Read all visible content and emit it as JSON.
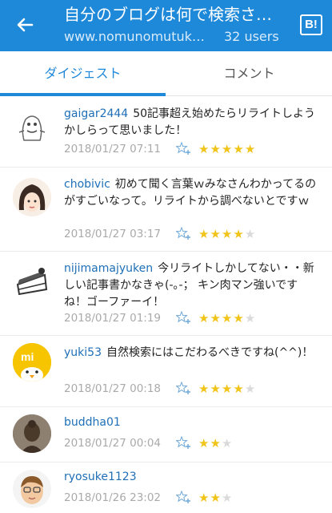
{
  "header": {
    "title": "自分のブログは何で検索さ…",
    "url": "www.nomunomutuk…",
    "users": "32 users",
    "hatena_logo": "B!",
    "back_icon": "arrow-left-icon",
    "background": "#1e88d9"
  },
  "tabs": [
    {
      "label": "ダイジェスト",
      "active": true
    },
    {
      "label": "コメント",
      "active": false
    }
  ],
  "comments": [
    {
      "user": "gaigar2444",
      "text": "50記事超え始めたらリライトしようかしらって思いました！",
      "date": "2018/01/27 07:11",
      "stars": 5,
      "max_stars": 5
    },
    {
      "user": "chobivic",
      "text": "初めて聞く言葉ｗみなさんわかってるのがすごいなって。リライトから調べないとですｗ",
      "date": "2018/01/27 03:17",
      "stars": 4,
      "max_stars": 5
    },
    {
      "user": "nijimamajyuken",
      "text": "今リライトしかしてない・・新しい記事書かなきゃ(-｡-； キン肉マン強いですね！ゴーファーイ！",
      "date": "2018/01/27 01:19",
      "stars": 4,
      "max_stars": 5
    },
    {
      "user": "yuki53",
      "text": "自然検索にはこだわるべきですね(^^)！",
      "date": "2018/01/27 00:18",
      "stars": 4,
      "max_stars": 5
    },
    {
      "user": "buddha01",
      "text": "",
      "date": "2018/01/27 00:04",
      "stars": 2,
      "max_stars": 3
    },
    {
      "user": "ryosuke1123",
      "text": "",
      "date": "2018/01/26 23:02",
      "stars": 2,
      "max_stars": 3
    }
  ],
  "colors": {
    "accent": "#1e88d9",
    "username": "#1e6fb7",
    "star": "#f0c419"
  }
}
